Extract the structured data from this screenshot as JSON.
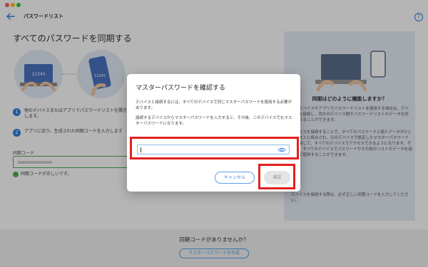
{
  "window": {
    "title": "パスワードリスト",
    "help_symbol": "?"
  },
  "page": {
    "heading": "すべてのパスワードを同期する",
    "step1": {
      "num": "1",
      "text": "他のデバイスまたはアプリでパスワードリストを開き、します。"
    },
    "step2": {
      "num": "2",
      "text": "アプリに戻り、生成された同期コードを入力します"
    },
    "code_label": "同期コード",
    "code_status": "同期コードが正しいです。"
  },
  "illustration": {
    "laptop_code": "12345",
    "phone_code": "12345"
  },
  "side_panel": {
    "title": "同期はどのように機能しますか？",
    "text1": "他のデバイスやアプリでパスワードリストを使用する場合は、デバイスを接続し、両方のデバイス間でパスワードリストのデータを同期させることができます。",
    "text2": "デバイスを接続することで、すべてのパスワードと個人データが1つのリストに統合され、元のデバイスで設定したマスターパスワードを使用して、すべてのデバイスでアクセスできるようになります。その後、すべてのデバイスでパスワードやその他のリストのデータを追加して使用することができます。",
    "text3": "デバイスを接続する際は、必ず正しい同期コードを入力してください。"
  },
  "footer": {
    "question": "同期コードがありませんか？",
    "button": "マスターパスワードを作成"
  },
  "dialog": {
    "title": "マスターパスワードを確認する",
    "text1": "デバイスと接続するには、すべてのデバイスで同じマスターパスワードを使用する必要があります。",
    "text2": "接続するデバイスからマスターパスワードを入力すると、その後、このデバイスでもマスターパスワードになります。",
    "password_value": "",
    "cancel": "キャンセル",
    "confirm": "確認"
  },
  "colors": {
    "accent": "#2f7fe0",
    "highlight": "#e3211f",
    "success": "#4cae4c"
  }
}
